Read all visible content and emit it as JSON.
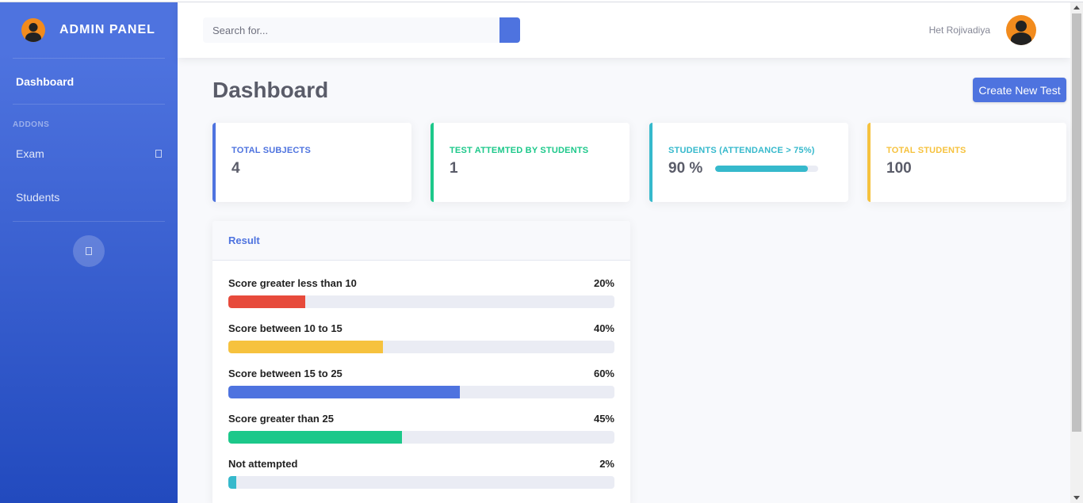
{
  "sidebar": {
    "brand": "ADMIN PANEL",
    "dashboard_label": "Dashboard",
    "heading": "ADDONS",
    "items": [
      {
        "label": "Exam"
      },
      {
        "label": "Students"
      }
    ]
  },
  "topbar": {
    "search_placeholder": "Search for...",
    "username": "Het Rojivadiya"
  },
  "main": {
    "title": "Dashboard",
    "create_button": "Create New Test"
  },
  "cards": [
    {
      "label": "TOTAL SUBJECTS",
      "value": "4",
      "color": "#4e73df"
    },
    {
      "label": "TEST ATTEMTED BY STUDENTS",
      "value": "1",
      "color": "#1cc88a"
    },
    {
      "label": "STUDENTS (ATTENDANCE > 75%)",
      "value": "90 %",
      "progress": 0.9,
      "color": "#36b9cc"
    },
    {
      "label": "TOTAL STUDENTS",
      "value": "100",
      "color": "#f6c23e"
    }
  ],
  "result": {
    "title": "Result",
    "rows": [
      {
        "label": "Score greater less than 10",
        "percent_text": "20%",
        "percent": 20,
        "color": "#e74a3b"
      },
      {
        "label": "Score between 10 to 15",
        "percent_text": "40%",
        "percent": 40,
        "color": "#f6c23e"
      },
      {
        "label": "Score between 15 to 25",
        "percent_text": "60%",
        "percent": 60,
        "color": "#4e73df"
      },
      {
        "label": "Score greater than 25",
        "percent_text": "45%",
        "percent": 45,
        "color": "#1cc88a"
      },
      {
        "label": "Not attempted",
        "percent_text": "2%",
        "percent": 2,
        "color": "#36b9cc"
      }
    ]
  },
  "icons": {
    "brand": "user-avatar-icon",
    "exam_chevron": "box-icon",
    "toggle": "box-icon",
    "search": "search-icon",
    "user": "user-avatar-icon"
  }
}
